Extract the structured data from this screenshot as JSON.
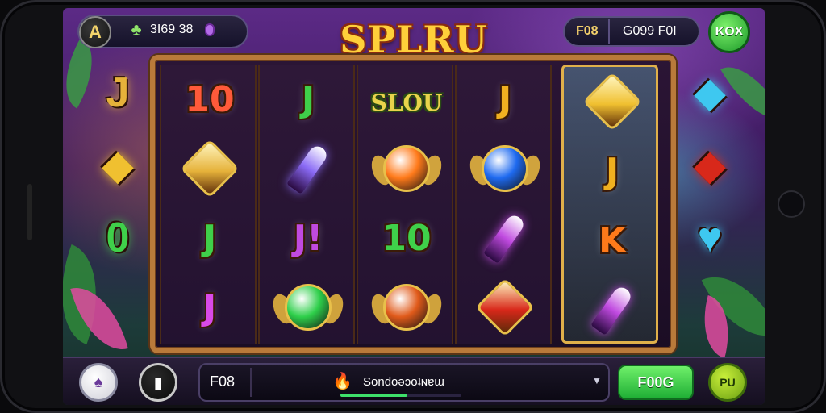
{
  "header": {
    "logo_letter": "A",
    "gem_glyph": "♣",
    "balance": "3I69 38",
    "win_label": "F08",
    "win_value": "G099 F0I",
    "top_button_label": "KOX"
  },
  "title": "SPLRU",
  "slot_banner": "SLOU",
  "bottom": {
    "autoplay_glyph": "♠",
    "info_glyph": "▮",
    "bet_label": "F08",
    "flame_glyph": "🔥",
    "bet_text": "Sondoəɔoʇɴɐɯ",
    "bet_progress": 0.55,
    "caret_glyph": "▼",
    "spin_label": "F00G",
    "menu_label": "PU"
  },
  "reels": [
    {
      "symbols": [
        {
          "kind": "text",
          "text": "10",
          "color": "#ff5a3a"
        },
        {
          "kind": "diamond",
          "color": "#e6b23a"
        },
        {
          "kind": "text",
          "text": "J",
          "color": "#3fd04a"
        },
        {
          "kind": "text",
          "text": "J",
          "color": "#d94ae8"
        }
      ]
    },
    {
      "symbols": [
        {
          "kind": "text",
          "text": "J",
          "color": "#3fd04a"
        },
        {
          "kind": "crystal",
          "color": "#8a6af5"
        },
        {
          "kind": "text",
          "text": "J!",
          "color": "#c04ae0"
        },
        {
          "kind": "gem",
          "color": "#2ecf4a"
        }
      ]
    },
    {
      "symbols": [
        {
          "kind": "banner"
        },
        {
          "kind": "gem",
          "color": "#ff7a1a"
        },
        {
          "kind": "text",
          "text": "10",
          "color": "#3fd04a"
        },
        {
          "kind": "gem",
          "color": "#e05a1a"
        }
      ]
    },
    {
      "symbols": [
        {
          "kind": "text",
          "text": "J",
          "color": "#f0b020"
        },
        {
          "kind": "gem",
          "color": "#1e6af0"
        },
        {
          "kind": "crystal",
          "color": "#c04ae0"
        },
        {
          "kind": "diamond",
          "color": "#d8281a"
        }
      ]
    },
    {
      "symbols": [
        {
          "kind": "diamond",
          "color": "#f0c030"
        },
        {
          "kind": "text",
          "text": "J",
          "color": "#f0b020"
        },
        {
          "kind": "text",
          "text": "K",
          "color": "#ff7a1a"
        },
        {
          "kind": "crystal",
          "color": "#c04ae0"
        }
      ]
    }
  ],
  "side_symbols_left": [
    {
      "text": "J",
      "color": "#e6b23a"
    },
    {
      "text": "◆",
      "color": "#f0c030"
    },
    {
      "text": "0",
      "color": "#3fd04a"
    }
  ],
  "side_symbols_right": [
    {
      "text": "◆",
      "color": "#3ec8f0"
    },
    {
      "text": "◆",
      "color": "#d8281a"
    },
    {
      "text": "♥",
      "color": "#3ec8f0"
    }
  ],
  "colors": {
    "accent_gold": "#e0b04a",
    "spin_green": "#1fae35",
    "frame_brown": "#b97a3a"
  }
}
